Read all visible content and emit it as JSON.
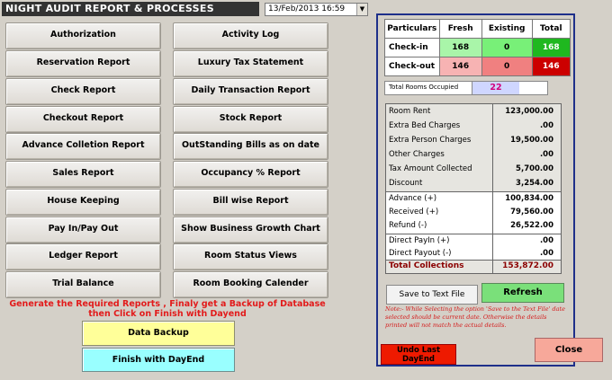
{
  "window": {
    "title": "NIGHT AUDIT REPORT & PROCESSES",
    "date_value": "13/Feb/2013 16:59",
    "dropdown_glyph": "▼"
  },
  "reports": {
    "left": [
      "Authorization",
      "Reservation Report",
      "Check Report",
      "Checkout Report",
      "Advance Colletion Report",
      "Sales Report",
      "House Keeping",
      "Pay In/Pay Out",
      "Ledger Report",
      "Trial Balance"
    ],
    "right": [
      "Activity Log",
      "Luxury Tax Statement",
      "Daily Transaction Report",
      "Stock Report",
      "OutStanding Bills as on date",
      "Occupancy % Report",
      "Bill wise Report",
      "Show Business Growth Chart",
      "Room Status Views",
      "Room Booking Calender"
    ]
  },
  "instruction": "Generate the Required Reports , Finaly get a Backup of Database then Click on Finish with Dayend",
  "actions": {
    "backup": "Data Backup",
    "finish": "Finish with DayEnd"
  },
  "stats": {
    "headers": [
      "Particulars",
      "Fresh",
      "Existing",
      "Total"
    ],
    "rows": [
      {
        "label": "Check-in",
        "fresh": "168",
        "existing": "0",
        "total": "168"
      },
      {
        "label": "Check-out",
        "fresh": "146",
        "existing": "0",
        "total": "146"
      }
    ],
    "occupied_label": "Total Rooms Occupied",
    "occupied_value": "22"
  },
  "finance": {
    "g1": [
      {
        "label": "Room Rent",
        "value": "123,000.00"
      },
      {
        "label": "Extra Bed Charges",
        "value": ".00"
      },
      {
        "label": "Extra Person Charges",
        "value": "19,500.00"
      },
      {
        "label": "Other Charges",
        "value": ".00"
      },
      {
        "label": "Tax Amount Collected",
        "value": "5,700.00"
      },
      {
        "label": "Discount",
        "value": "3,254.00"
      }
    ],
    "g2": [
      {
        "label": "Advance (+)",
        "value": "100,834.00"
      },
      {
        "label": "Received (+)",
        "value": "79,560.00"
      },
      {
        "label": "Refund (-)",
        "value": "26,522.00"
      }
    ],
    "g3": [
      {
        "label": "Direct PayIn (+)",
        "value": ".00"
      },
      {
        "label": "Direct Payout (-)",
        "value": ".00"
      }
    ],
    "total": {
      "label": "Total Collections",
      "value": "153,872.00"
    }
  },
  "panel_actions": {
    "save": "Save to Text File",
    "refresh": "Refresh",
    "note": "Note:- While Selecting the option 'Save to the Text File' date selected should be current date. Otherwise the details printed will not match the actual details.",
    "undo": "Undo Last DayEnd",
    "close": "Close"
  },
  "colors": {
    "title_bg": "#333333",
    "panel_border": "#1e2f8a",
    "checkin_total": "#1fb81f",
    "checkout_total": "#cc0000",
    "warning_text": "#e21b1b"
  }
}
